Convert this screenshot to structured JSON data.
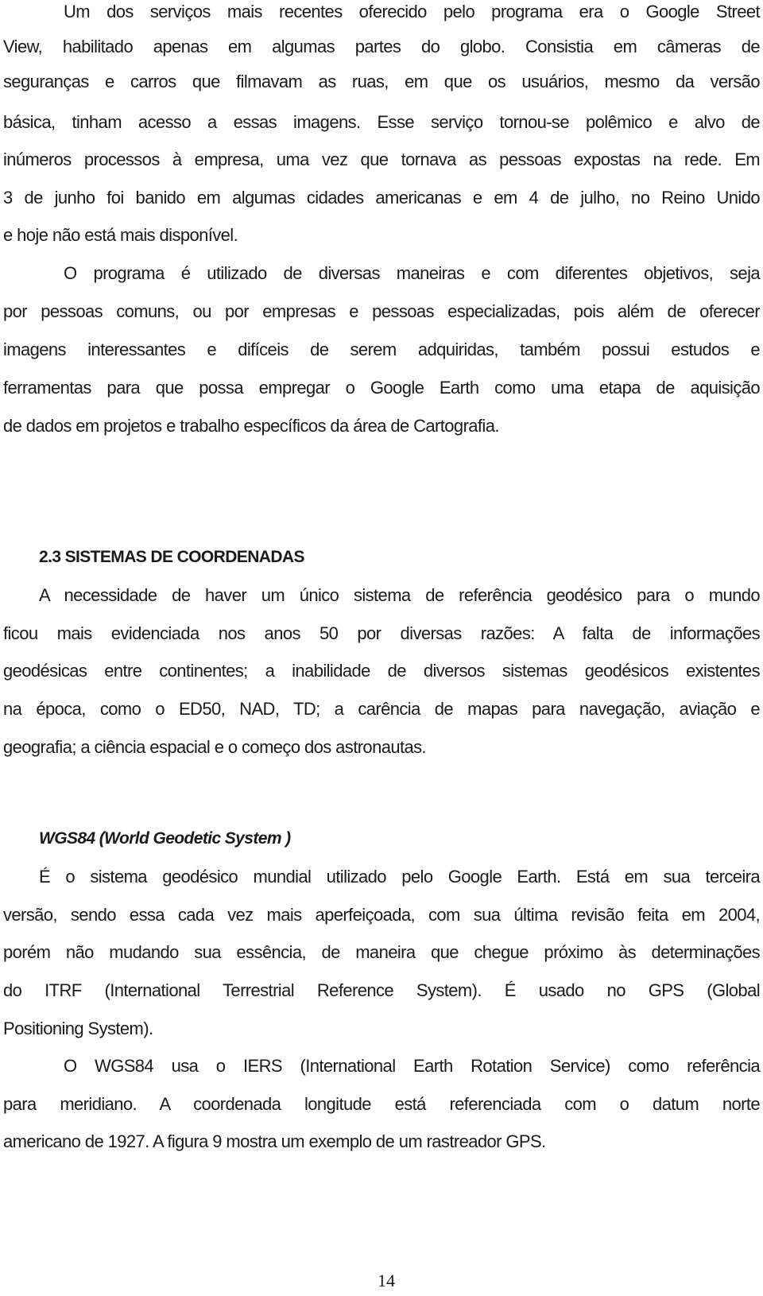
{
  "page": {
    "paragraph_1": {
      "lines": [
        "Um dos serviços mais recentes oferecido pelo programa era o Google Street",
        "View, habilitado apenas em algumas partes do globo. Consistia em câmeras de",
        "seguranças e carros que filmavam as ruas, em que os usuários, mesmo da versão",
        "básica, tinham acesso a essas imagens. Esse serviço tornou-se polêmico e alvo de",
        "inúmeros processos à empresa, uma vez que tornava as pessoas expostas na rede. Em",
        "3 de junho foi banido em algumas cidades americanas e em 4 de julho, no Reino Unido",
        "e hoje não está mais disponível."
      ]
    },
    "paragraph_2": {
      "lines": [
        "O programa é utilizado de diversas maneiras e com diferentes objetivos, seja",
        "por pessoas comuns, ou por empresas e pessoas especializadas, pois além de oferecer",
        "imagens interessantes e difíceis de serem adquiridas, também possui estudos e",
        "ferramentas para que possa empregar o Google Earth como uma etapa de aquisição",
        "de dados em projetos e trabalho específicos da área de Cartografia."
      ]
    },
    "section_heading": "2.3 SISTEMAS DE COORDENADAS",
    "paragraph_3": {
      "lines": [
        "A necessidade de haver um único sistema de referência geodésico para o mundo",
        "ficou mais evidenciada nos anos 50 por diversas razões: A falta de informações",
        "geodésicas entre continentes; a inabilidade de diversos sistemas geodésicos existentes",
        "na época, como o ED50, NAD, TD; a carência de mapas para navegação, aviação e",
        "geografia; a ciência espacial e o começo dos astronautas."
      ]
    },
    "subheading": "WGS84 (World Geodetic System )",
    "paragraph_4": {
      "lines": [
        "É o sistema geodésico mundial utilizado pelo Google Earth. Está em sua terceira",
        "versão, sendo essa cada vez mais aperfeiçoada, com sua última revisão feita em 2004,",
        "porém não mudando sua essência, de maneira que chegue próximo às determinações",
        "do ITRF (International Terrestrial Reference System). É usado no GPS (Global",
        "Positioning System)."
      ]
    },
    "paragraph_5": {
      "lines": [
        "O WGS84 usa o IERS (International Earth Rotation Service) como referência",
        "para meridiano. A coordenada longitude está referenciada com o datum norte",
        "americano de 1927. A figura 9 mostra um exemplo de um rastreador GPS."
      ]
    },
    "page_number": "14"
  }
}
